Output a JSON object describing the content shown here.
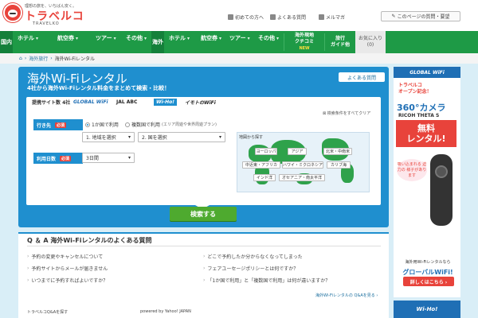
{
  "header": {
    "tagline": "理想の旅を、いちばん安く。",
    "brand": "トラベルコ",
    "brand_sub": "TRAVELKO",
    "links": [
      "初めての方へ",
      "よくある質問",
      "メルマガ"
    ],
    "request_button": "このページの質問・要望"
  },
  "nav": {
    "domestic_tag": "国内",
    "overseas_tag": "海外",
    "domestic_items": [
      "ホテル",
      "航空券",
      "ツアー",
      "その他"
    ],
    "overseas_items": [
      "ホテル",
      "航空券",
      "ツアー",
      "その他"
    ],
    "kuchikomi_l1": "海外現地",
    "kuchikomi_l2": "クチコミ",
    "kuchikomi_badge": "NEW",
    "guide_l1": "旅行",
    "guide_l2": "ガイド他",
    "fav_l1": "お気に入り",
    "fav_count": "(0)"
  },
  "breadcrumb": [
    "海外旅行",
    "海外Wi-Fiレンタル"
  ],
  "search": {
    "title": "海外Wi-Fiレンタル",
    "subtitle": "4社から海外Wi-Fiレンタル料金をまとめて検索・比較！",
    "faq_button": "よくある質問",
    "compare_label": "提携サイト数 4社",
    "providers": [
      "GLOBAL WiFi",
      "JAL ABC",
      "Wi-Ho!",
      "イモトのWiFi"
    ],
    "clear_link": "検索条件をすべてクリア",
    "destination_label": "行き先",
    "required": "必須",
    "radio_single": "1か国で利用",
    "radio_multi": "複数国で利用",
    "radio_multi_note": "(エリア周遊や世界周遊プラン)",
    "select_area": "1. 地域を選択",
    "select_country": "2. 国を選択",
    "days_label": "利用日数",
    "days_value": "3日間",
    "map_title": "地図から探す",
    "regions": [
      "ヨーロッパ",
      "アジア",
      "北米・中南米",
      "中近東・アフリカ",
      "ハワイ・ミクロネシア",
      "カリブ海",
      "インド洋",
      "オセアニア・南太平洋"
    ],
    "search_button": "検索する"
  },
  "qa": {
    "title": "Q ＆ A 海外Wi-Fiレンタルのよくある質問",
    "left_items": [
      "予約の変更やキャンセルについて",
      "予約サイトからメールが届きません",
      "いつまでに予約すればよいですか？"
    ],
    "right_items": [
      "どこで予約したか分からなくなってしまった",
      "フェアユーセージポリシーとは何ですか？",
      "「1か国で利用」と「複数国で利用」は何が違いますか？"
    ],
    "more": "海外Wi-Fiレンタルの Q&Aを見る",
    "search_label": "トラベルコQ&Aを探す",
    "powered": "powered by Yahoo! JAPAN"
  },
  "ad": {
    "top": "GLOBAL WiFi",
    "open_l1": "トラベルコ",
    "open_l2": "オープン記念！",
    "camera": "360°カメラ",
    "ricoh": "RICOH THETA S",
    "rent_l1": "無料",
    "rent_l2": "レンタル!",
    "bubble": "吸い込まれる 迫力の 様子があります",
    "bottom_text": "海外用Wi-Fiレンタルなら",
    "bottom_big": "グローバルWiFi!",
    "detail_button": "詳しくはこちら ›",
    "ad2": "Wi-Ho!"
  },
  "colors": {
    "brand_red": "#e8433b",
    "nav_green": "#1e9a46",
    "panel_blue": "#1f8fcf",
    "search_green": "#4eaa2f"
  }
}
